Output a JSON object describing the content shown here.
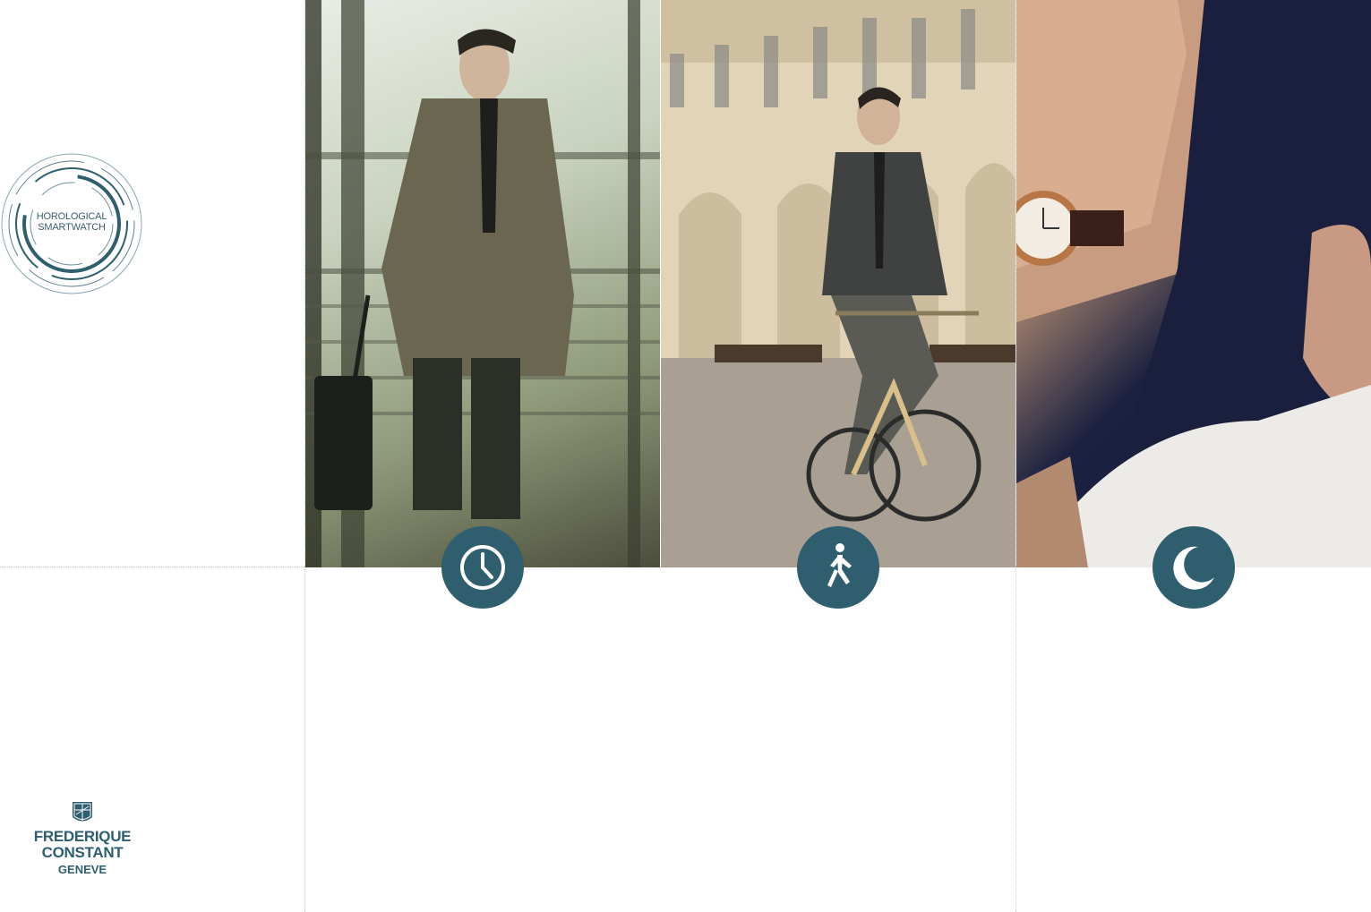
{
  "badge": {
    "line1": "HOROLOGICAL",
    "line2": "SMARTWATCH"
  },
  "brand": {
    "name": "FREDERIQUE CONSTANT",
    "city": "GENEVE"
  },
  "panels": [
    {
      "photo": "man-with-luggage-photo",
      "icon": "clock-icon"
    },
    {
      "photo": "man-on-bicycle-photo",
      "icon": "walking-person-icon"
    },
    {
      "photo": "sleeping-man-with-watch-photo",
      "icon": "moon-icon"
    }
  ],
  "colors": {
    "accent": "#2f5f6e",
    "divider": "#c9c9c9",
    "background": "#ffffff"
  }
}
